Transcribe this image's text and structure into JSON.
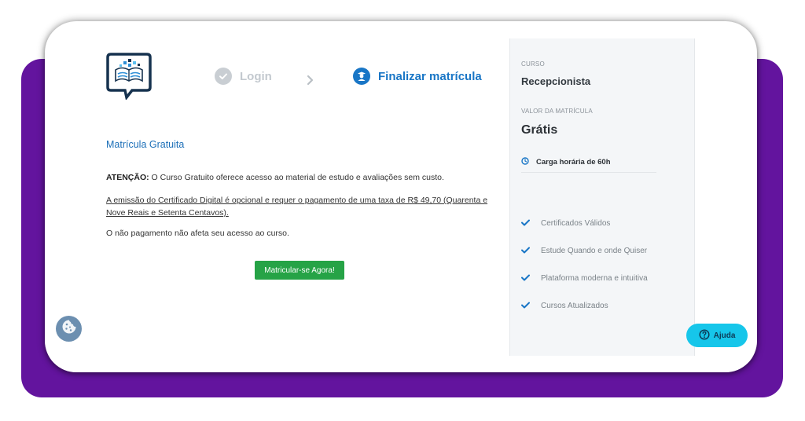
{
  "colors": {
    "purple_bg": "#63149e",
    "primary_blue": "#1976c6",
    "button_green": "#26a346",
    "help_cyan": "#16c6ea"
  },
  "header": {
    "logo_icon": "book-chat-logo-icon",
    "steps": [
      {
        "label": "Login",
        "icon": "check-circle-icon",
        "state": "completed"
      },
      {
        "label": "Finalizar matrícula",
        "icon": "graduate-user-icon",
        "state": "active"
      }
    ],
    "separator_icon": "chevron-right-icon"
  },
  "main": {
    "title": "Matrícula Gratuita",
    "notice_strong": "ATENÇÃO:",
    "notice_text": " O Curso Gratuito oferece acesso ao material de estudo e avaliações sem custo.",
    "certificate_text": "A emissão do Certificado Digital é opcional e requer o pagamento de uma taxa de R$ 49,70 (Quarenta e Nove Reais e Setenta Centavos).",
    "no_payment_text": "O não pagamento não afeta seu acesso ao curso.",
    "enroll_button": "Matricular-se Agora!"
  },
  "sidebar": {
    "course_label": "CURSO",
    "course_name": "Recepcionista",
    "price_label": "VALOR DA MATRÍCULA",
    "price": "Grátis",
    "hours": "Carga horária de 60h",
    "features": [
      "Certificados Válidos",
      "Estude Quando e onde Quiser",
      "Plataforma moderna e intuitiva",
      "Cursos Atualizados"
    ]
  },
  "help": {
    "label": "Ajuda",
    "icon": "question-circle-icon"
  },
  "cookie": {
    "icon": "cookie-icon"
  }
}
